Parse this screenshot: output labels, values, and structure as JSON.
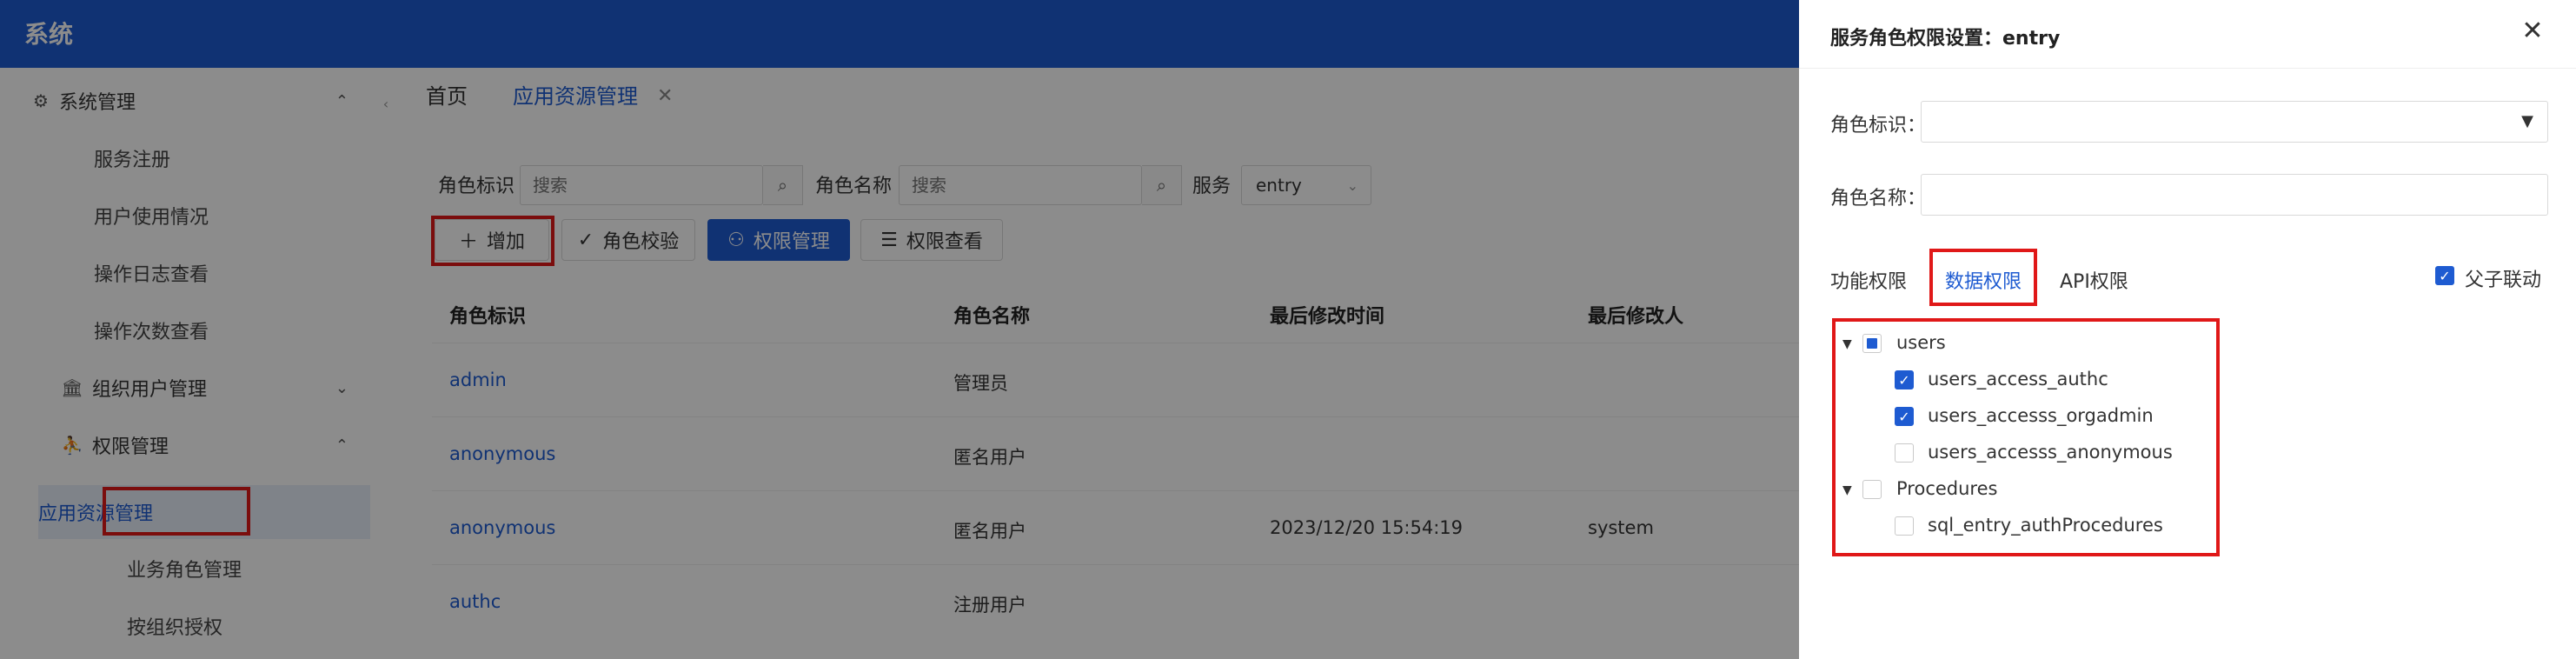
{
  "app": {
    "title": "系统"
  },
  "sidebar": {
    "items": [
      {
        "label": "系统管理",
        "icon": "gear-icon",
        "chevron": "up"
      },
      {
        "label": "服务注册"
      },
      {
        "label": "用户使用情况"
      },
      {
        "label": "操作日志查看"
      },
      {
        "label": "操作次数查看"
      },
      {
        "label": "组织用户管理",
        "icon": "bank-icon",
        "chevron": "down"
      },
      {
        "label": "权限管理",
        "icon": "user-icon",
        "chevron": "up"
      },
      {
        "label": "应用资源管理"
      },
      {
        "label": "业务角色管理"
      },
      {
        "label": "按组织授权"
      }
    ]
  },
  "tabs": {
    "home": "首页",
    "active": "应用资源管理",
    "close": "✕"
  },
  "filters": {
    "role_id_label": "角色标识",
    "role_id_placeholder": "搜索",
    "role_name_label": "角色名称",
    "role_name_placeholder": "搜索",
    "service_label": "服务",
    "service_value": "entry"
  },
  "toolbar": {
    "add": "增加",
    "verify": "角色校验",
    "perm_manage": "权限管理",
    "perm_view": "权限查看"
  },
  "table": {
    "columns": [
      "角色标识",
      "角色名称",
      "最后修改时间",
      "最后修改人"
    ],
    "rows": [
      {
        "id": "admin",
        "name": "管理员",
        "time": "",
        "user": ""
      },
      {
        "id": "anonymous",
        "name": "匿名用户",
        "time": "",
        "user": ""
      },
      {
        "id": "anonymous",
        "name": "匿名用户",
        "time": "2023/12/20 15:54:19",
        "user": "system"
      },
      {
        "id": "authc",
        "name": "注册用户",
        "time": "",
        "user": ""
      }
    ]
  },
  "drawer": {
    "title": "服务角色权限设置：entry",
    "role_id_label": "角色标识：",
    "role_name_label": "角色名称：",
    "tabs": [
      "功能权限",
      "数据权限",
      "API权限"
    ],
    "linkage_label": "父子联动",
    "linkage_checked": true,
    "tree": [
      {
        "label": "users",
        "state": "indeterminate",
        "children": [
          {
            "label": "users_access_authc",
            "checked": true
          },
          {
            "label": "users_accesss_orgadmin",
            "checked": true
          },
          {
            "label": "users_accesss_anonymous",
            "checked": false
          }
        ]
      },
      {
        "label": "Procedures",
        "state": "unchecked",
        "children": [
          {
            "label": "sql_entry_authProcedures",
            "checked": false
          }
        ]
      }
    ]
  },
  "colors": {
    "primary": "#1e5bd1",
    "highlight": "#e01818"
  }
}
